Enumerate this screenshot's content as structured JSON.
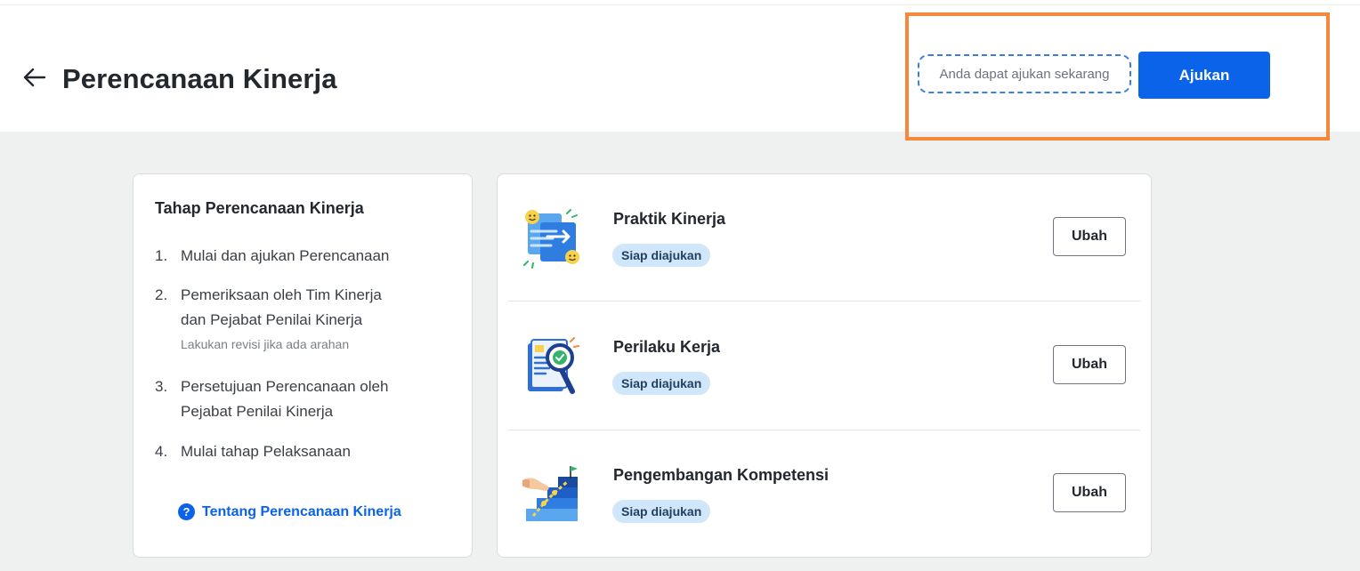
{
  "header": {
    "title": "Perencanaan Kinerja",
    "back_icon": "arrow-left-icon",
    "hint": "Anda dapat ajukan sekarang",
    "submit_label": "Ajukan"
  },
  "colors": {
    "primary": "#0a63e8",
    "highlight": "#f5883a",
    "badge_bg": "#cfe6fb",
    "content_bg": "#eff1f1"
  },
  "steps": {
    "title": "Tahap Perencanaan Kinerja",
    "items": [
      {
        "num": "1.",
        "lines": [
          "Mulai dan ajukan Perencanaan"
        ],
        "note": ""
      },
      {
        "num": "2.",
        "lines": [
          "Pemeriksaan oleh Tim Kinerja",
          "dan Pejabat Penilai Kinerja"
        ],
        "note": "Lakukan revisi jika ada arahan"
      },
      {
        "num": "3.",
        "lines": [
          "Persetujuan Perencanaan oleh",
          "Pejabat Penilai Kinerja"
        ],
        "note": ""
      },
      {
        "num": "4.",
        "lines": [
          "Mulai tahap Pelaksanaan"
        ],
        "note": ""
      }
    ],
    "link_label": "Tentang Perencanaan Kinerja",
    "link_icon": "help-circle-icon",
    "help_glyph": "?"
  },
  "items": [
    {
      "title": "Praktik Kinerja",
      "status": "Siap diajukan",
      "action": "Ubah",
      "icon": "practice-illustration-icon"
    },
    {
      "title": "Perilaku Kerja",
      "status": "Siap diajukan",
      "action": "Ubah",
      "icon": "behavior-review-illustration-icon"
    },
    {
      "title": "Pengembangan Kompetensi",
      "status": "Siap diajukan",
      "action": "Ubah",
      "icon": "competency-stairs-illustration-icon"
    }
  ]
}
